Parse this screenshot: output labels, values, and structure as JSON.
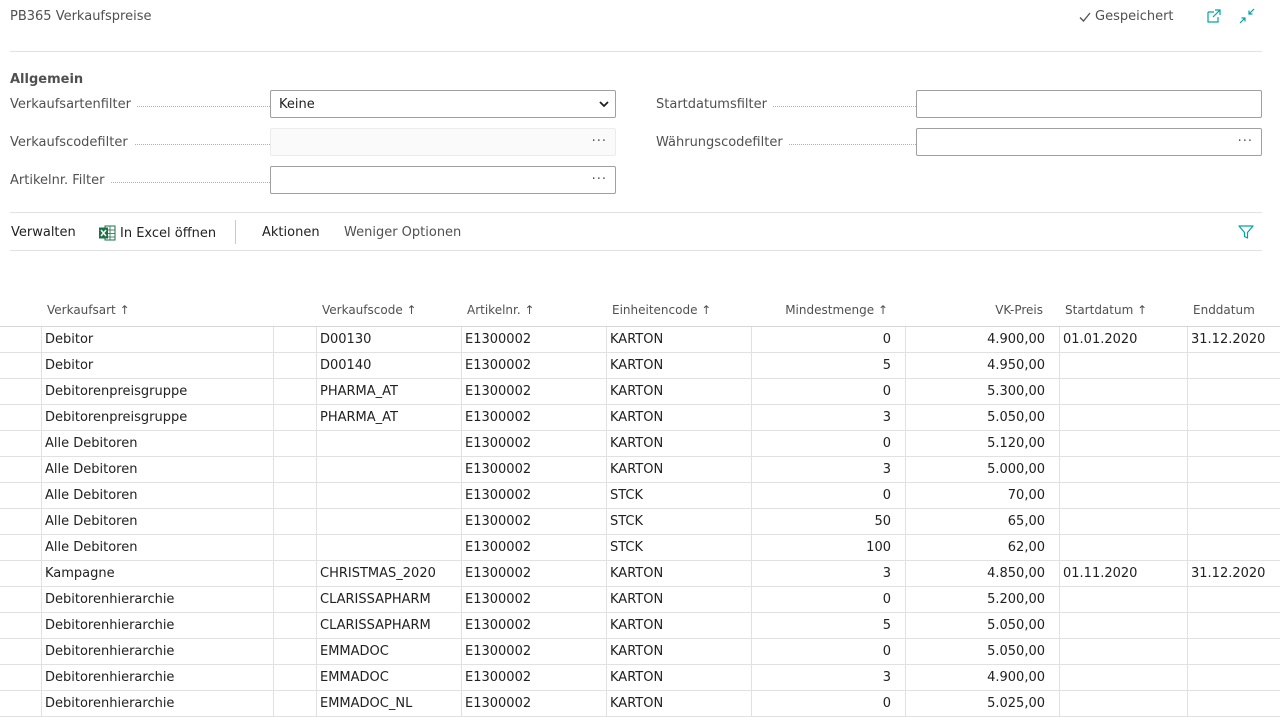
{
  "header": {
    "title": "PB365 Verkaufspreise",
    "saved_label": "Gespeichert",
    "open_new_window_icon": "open-in-new-window-icon",
    "collapse_icon": "collapse-icon"
  },
  "general": {
    "section_title": "Allgemein",
    "sales_type_filter": {
      "label": "Verkaufsartenfilter",
      "value": "Keine"
    },
    "sales_code_filter": {
      "label": "Verkaufscodefilter",
      "value": ""
    },
    "item_no_filter": {
      "label": "Artikelnr. Filter",
      "value": ""
    },
    "start_date_filter": {
      "label": "Startdatumsfilter",
      "value": ""
    },
    "currency_code_filter": {
      "label": "Währungscodefilter",
      "value": ""
    }
  },
  "actions": {
    "manage": "Verwalten",
    "open_excel": "In Excel öffnen",
    "actions": "Aktionen",
    "fewer_options": "Weniger Optionen"
  },
  "table": {
    "columns": {
      "sales_type": "Verkaufsart",
      "sales_code": "Verkaufscode",
      "item_no": "Artikelnr.",
      "unit_code": "Einheitencode",
      "min_qty": "Mindestmenge",
      "price": "VK-Preis",
      "start_date": "Startdatum",
      "end_date": "Enddatum"
    },
    "rows": [
      {
        "sales_type": "Debitor",
        "sales_code": "D00130",
        "item_no": "E1300002",
        "unit_code": "KARTON",
        "min_qty": "0",
        "price": "4.900,00",
        "start_date": "01.01.2020",
        "end_date": "31.12.2020"
      },
      {
        "sales_type": "Debitor",
        "sales_code": "D00140",
        "item_no": "E1300002",
        "unit_code": "KARTON",
        "min_qty": "5",
        "price": "4.950,00",
        "start_date": "",
        "end_date": ""
      },
      {
        "sales_type": "Debitorenpreisgruppe",
        "sales_code": "PHARMA_AT",
        "item_no": "E1300002",
        "unit_code": "KARTON",
        "min_qty": "0",
        "price": "5.300,00",
        "start_date": "",
        "end_date": ""
      },
      {
        "sales_type": "Debitorenpreisgruppe",
        "sales_code": "PHARMA_AT",
        "item_no": "E1300002",
        "unit_code": "KARTON",
        "min_qty": "3",
        "price": "5.050,00",
        "start_date": "",
        "end_date": ""
      },
      {
        "sales_type": "Alle Debitoren",
        "sales_code": "",
        "item_no": "E1300002",
        "unit_code": "KARTON",
        "min_qty": "0",
        "price": "5.120,00",
        "start_date": "",
        "end_date": ""
      },
      {
        "sales_type": "Alle Debitoren",
        "sales_code": "",
        "item_no": "E1300002",
        "unit_code": "KARTON",
        "min_qty": "3",
        "price": "5.000,00",
        "start_date": "",
        "end_date": ""
      },
      {
        "sales_type": "Alle Debitoren",
        "sales_code": "",
        "item_no": "E1300002",
        "unit_code": "STCK",
        "min_qty": "0",
        "price": "70,00",
        "start_date": "",
        "end_date": ""
      },
      {
        "sales_type": "Alle Debitoren",
        "sales_code": "",
        "item_no": "E1300002",
        "unit_code": "STCK",
        "min_qty": "50",
        "price": "65,00",
        "start_date": "",
        "end_date": ""
      },
      {
        "sales_type": "Alle Debitoren",
        "sales_code": "",
        "item_no": "E1300002",
        "unit_code": "STCK",
        "min_qty": "100",
        "price": "62,00",
        "start_date": "",
        "end_date": ""
      },
      {
        "sales_type": "Kampagne",
        "sales_code": "CHRISTMAS_2020",
        "item_no": "E1300002",
        "unit_code": "KARTON",
        "min_qty": "3",
        "price": "4.850,00",
        "start_date": "01.11.2020",
        "end_date": "31.12.2020"
      },
      {
        "sales_type": "Debitorenhierarchie",
        "sales_code": "CLARISSAPHARM",
        "item_no": "E1300002",
        "unit_code": "KARTON",
        "min_qty": "0",
        "price": "5.200,00",
        "start_date": "",
        "end_date": ""
      },
      {
        "sales_type": "Debitorenhierarchie",
        "sales_code": "CLARISSAPHARM",
        "item_no": "E1300002",
        "unit_code": "KARTON",
        "min_qty": "5",
        "price": "5.050,00",
        "start_date": "",
        "end_date": ""
      },
      {
        "sales_type": "Debitorenhierarchie",
        "sales_code": "EMMADOC",
        "item_no": "E1300002",
        "unit_code": "KARTON",
        "min_qty": "0",
        "price": "5.050,00",
        "start_date": "",
        "end_date": ""
      },
      {
        "sales_type": "Debitorenhierarchie",
        "sales_code": "EMMADOC",
        "item_no": "E1300002",
        "unit_code": "KARTON",
        "min_qty": "3",
        "price": "4.900,00",
        "start_date": "",
        "end_date": ""
      },
      {
        "sales_type": "Debitorenhierarchie",
        "sales_code": "EMMADOC_NL",
        "item_no": "E1300002",
        "unit_code": "KARTON",
        "min_qty": "0",
        "price": "5.025,00",
        "start_date": "",
        "end_date": ""
      }
    ]
  },
  "colors": {
    "accent": "#00a3a3",
    "excel_green": "#1e7145",
    "border": "#e1e1e1",
    "text_muted": "#505050"
  }
}
